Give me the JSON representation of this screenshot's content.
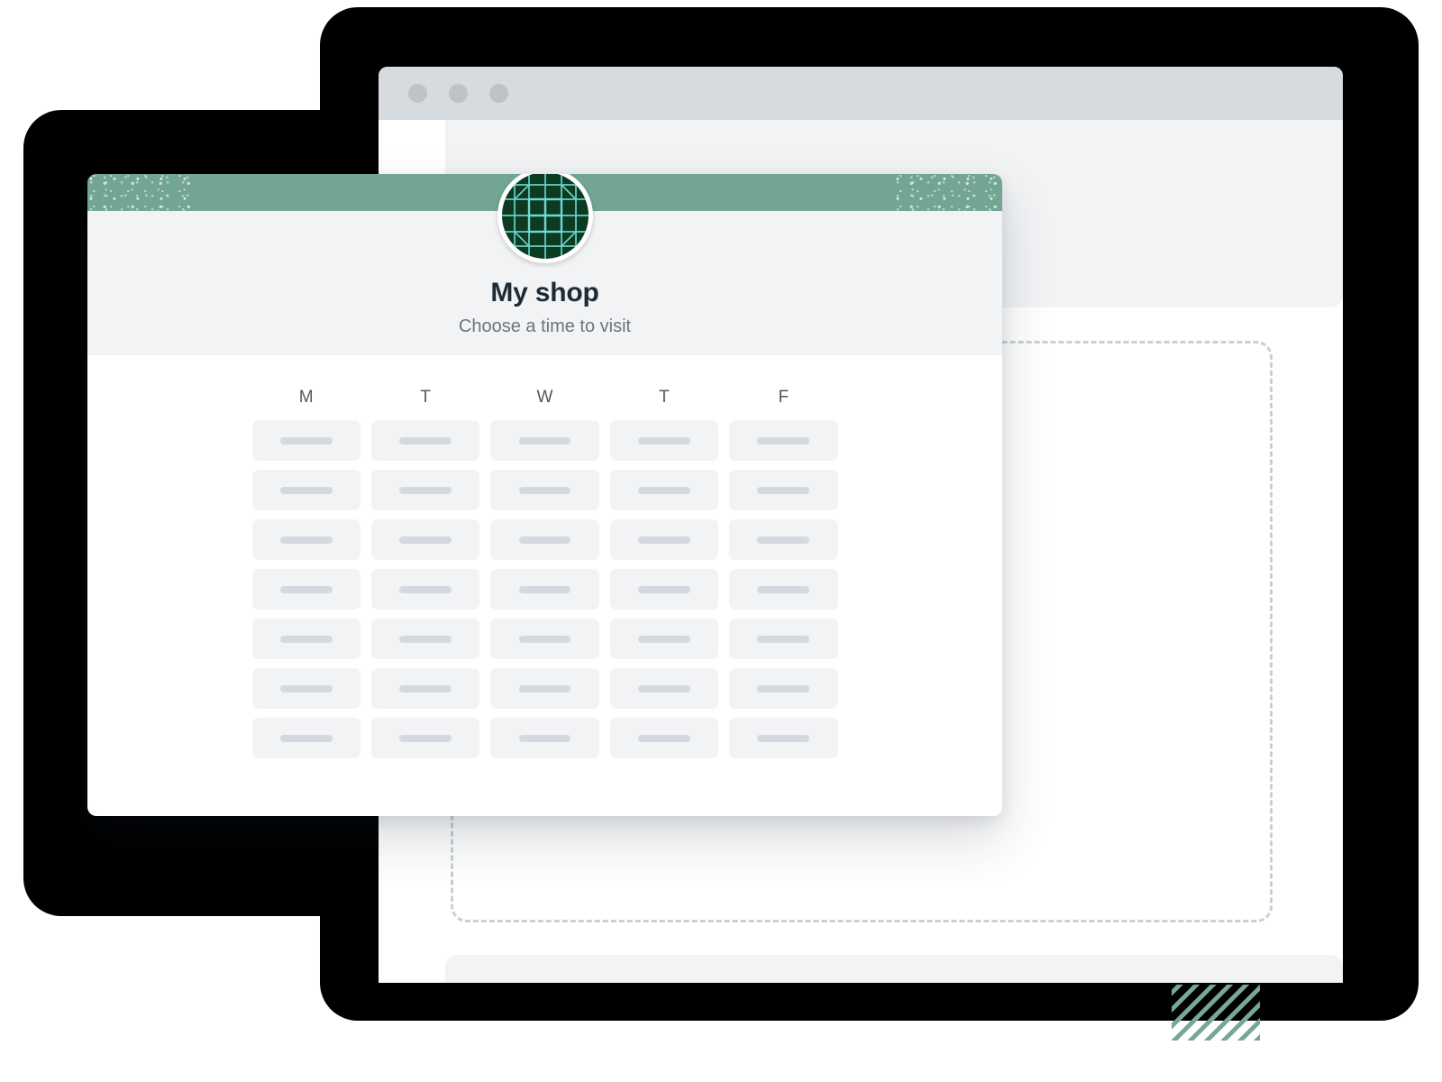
{
  "browser_window": {
    "name": "browser-window",
    "traffic_lights": [
      "close-dot",
      "minimize-dot",
      "maximize-dot"
    ],
    "placeholder_regions": [
      "top-panel",
      "dashed-drop-area",
      "bottom-panel"
    ]
  },
  "decorations": {
    "dots_pattern_color": "#1278be",
    "stripes_pattern_color": "#77a894",
    "device_frame_color": "#000000"
  },
  "booking_card": {
    "accent_bar_color": "#72a693",
    "logo": {
      "icon": "shop-grid-logo-icon",
      "background_color": "#0c3b22",
      "line_color": "#6fd9d4"
    },
    "title": "My shop",
    "subtitle": "Choose a time to visit",
    "calendar": {
      "day_headers": [
        "M",
        "T",
        "W",
        "T",
        "F"
      ],
      "rows": 7,
      "columns": 5,
      "slot_state": "loading-skeleton",
      "slot_background": "#f1f3f5",
      "slot_bar_color": "#d3d9df",
      "slots": [
        [
          "",
          "",
          "",
          "",
          ""
        ],
        [
          "",
          "",
          "",
          "",
          ""
        ],
        [
          "",
          "",
          "",
          "",
          ""
        ],
        [
          "",
          "",
          "",
          "",
          ""
        ],
        [
          "",
          "",
          "",
          "",
          ""
        ],
        [
          "",
          "",
          "",
          "",
          ""
        ],
        [
          "",
          "",
          "",
          "",
          ""
        ]
      ]
    }
  }
}
